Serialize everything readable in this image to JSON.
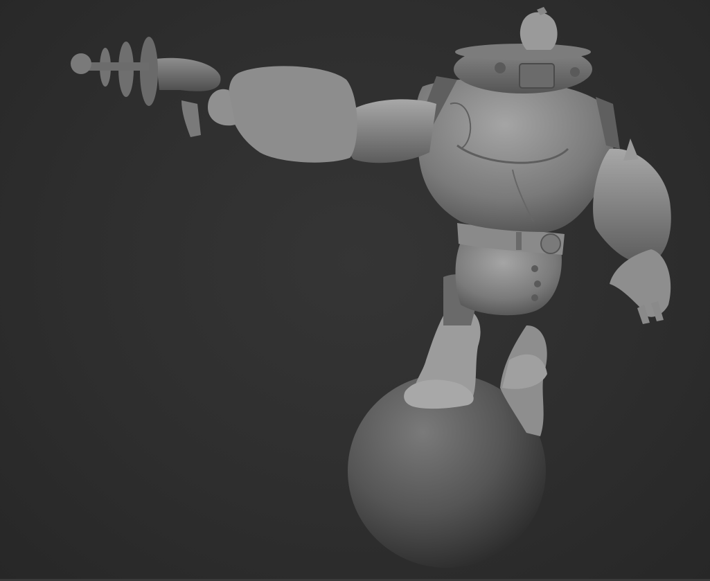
{
  "viewport": {
    "background": "#2d2d2d",
    "material_light": "#9a9a9a",
    "material_mid": "#6e6e6e",
    "material_dark": "#3c3c3c"
  },
  "model": {
    "icon": "sculpt-model"
  }
}
